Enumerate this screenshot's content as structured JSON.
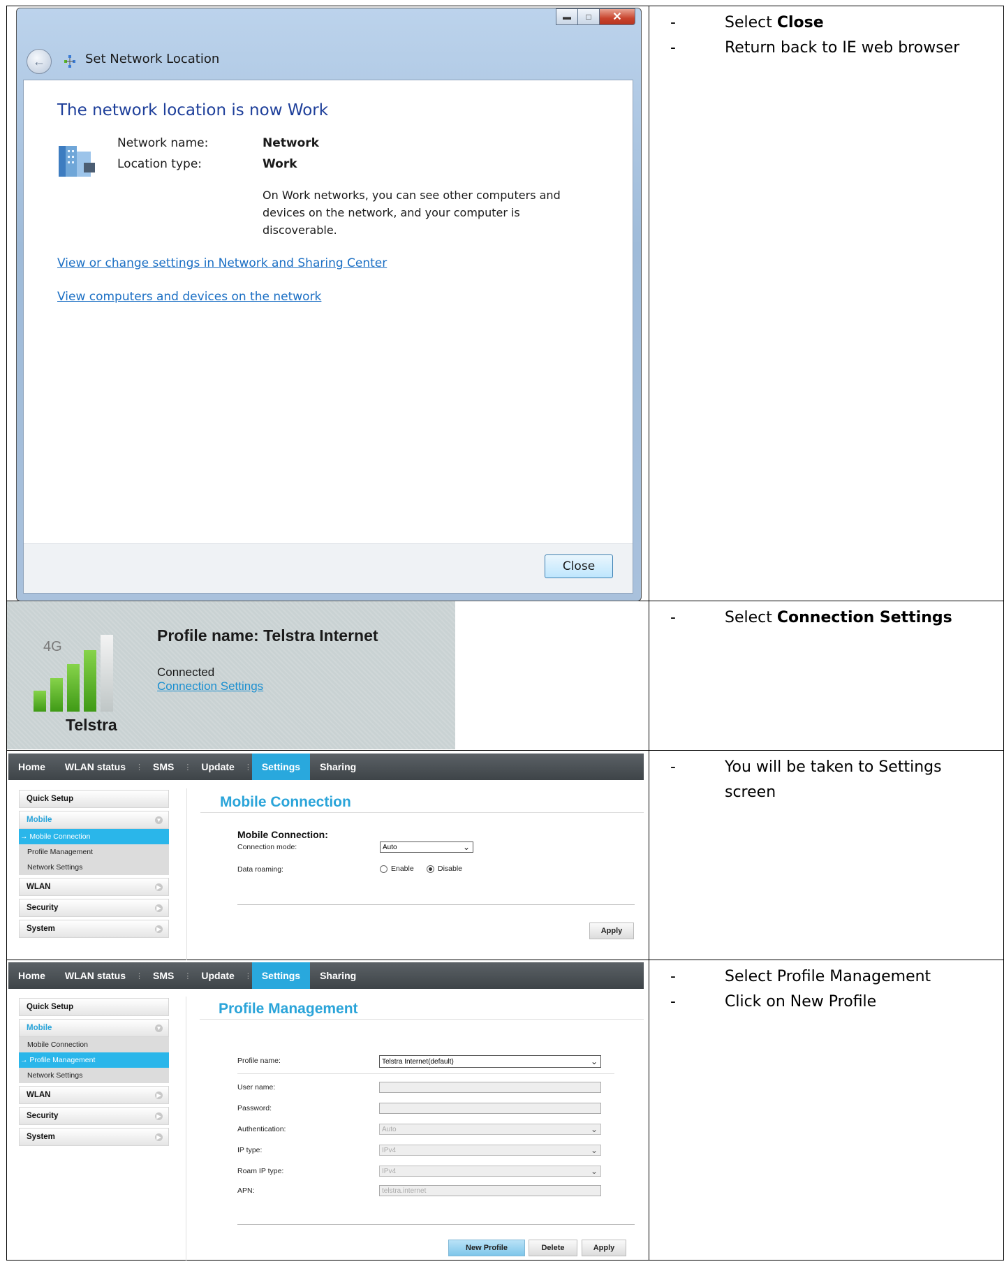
{
  "rows": [
    {
      "steps": [
        {
          "text_pre": "Select ",
          "bold": "Close",
          "text_post": ""
        },
        {
          "text_pre": "Return back to IE web browser",
          "bold": "",
          "text_post": ""
        }
      ]
    },
    {
      "steps": [
        {
          "text_pre": "Select ",
          "bold": "Connection Settings",
          "text_post": ""
        }
      ]
    },
    {
      "steps": [
        {
          "text_pre": "You will be taken to Settings screen",
          "bold": "",
          "text_post": ""
        }
      ]
    },
    {
      "steps": [
        {
          "text_pre": "Select Profile Management",
          "bold": "",
          "text_post": ""
        },
        {
          "text_pre": "Click on New Profile",
          "bold": "",
          "text_post": ""
        }
      ]
    }
  ],
  "dialog": {
    "title": "Set Network Location",
    "heading": "The network location is now Work",
    "network_name_label": "Network name:",
    "network_name_value": "Network",
    "location_type_label": "Location type:",
    "location_type_value": "Work",
    "description": "On Work networks, you can see other computers and devices on the network, and your computer is discoverable.",
    "link1": "View or change settings in Network and Sharing Center",
    "link2": "View computers and devices on the network",
    "close_label": "Close",
    "back_icon": "back-arrow-icon"
  },
  "telstra": {
    "network_type": "4G",
    "profile_line": "Profile name:  Telstra Internet",
    "status": "Connected",
    "settings_link": "Connection Settings",
    "brand": "Telstra",
    "signal_bars_filled": 4,
    "signal_bars_total": 5
  },
  "nav": {
    "items": [
      "Home",
      "WLAN status",
      "SMS",
      "Update",
      "Settings",
      "Sharing"
    ],
    "active": "Settings"
  },
  "sidebar": {
    "quick_setup": "Quick Setup",
    "mobile": "Mobile",
    "mobile_items": [
      "Mobile Connection",
      "Profile Management",
      "Network Settings"
    ],
    "wlan": "WLAN",
    "security": "Security",
    "system": "System"
  },
  "mobile_connection": {
    "title": "Mobile Connection",
    "section": "Mobile Connection:",
    "mode_label": "Connection mode:",
    "mode_value": "Auto",
    "roaming_label": "Data roaming:",
    "enable_label": "Enable",
    "disable_label": "Disable",
    "roaming_selected": "Disable",
    "apply_label": "Apply"
  },
  "profile_management": {
    "title": "Profile Management",
    "profile_name_label": "Profile name:",
    "profile_name_value": "Telstra Internet(default)",
    "username_label": "User name:",
    "password_label": "Password:",
    "auth_label": "Authentication:",
    "auth_value": "Auto",
    "ip_type_label": "IP type:",
    "ip_type_value": "IPv4",
    "roam_ip_label": "Roam IP type:",
    "roam_ip_value": "IPv4",
    "apn_label": "APN:",
    "apn_value": "telstra.internet",
    "new_profile_label": "New Profile",
    "delete_label": "Delete",
    "apply_label": "Apply"
  },
  "colors": {
    "accent": "#29a8dd",
    "link": "#1b6fc4",
    "heading": "#1e3f9a",
    "signal_green": "#5bb626"
  }
}
